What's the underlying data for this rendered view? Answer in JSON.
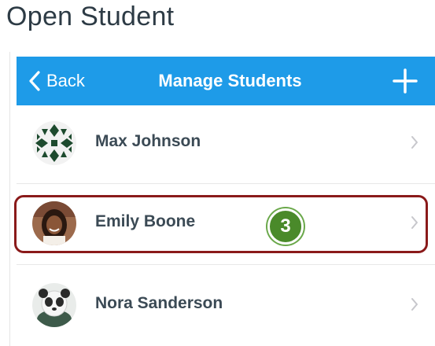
{
  "page_title": "Open Student",
  "navbar": {
    "back_label": "Back",
    "title": "Manage Students",
    "add_icon": "plus-icon",
    "color": "#1e9be8"
  },
  "students": [
    {
      "name": "Max Johnson",
      "avatar": "geometric-pattern-avatar"
    },
    {
      "name": "Emily Boone",
      "avatar": "photo-avatar"
    },
    {
      "name": "Nora Sanderson",
      "avatar": "panda-avatar"
    }
  ],
  "callout": {
    "step_number": "3",
    "highlight_color": "#8a1a1a",
    "badge_color": "#4a8a2a"
  }
}
